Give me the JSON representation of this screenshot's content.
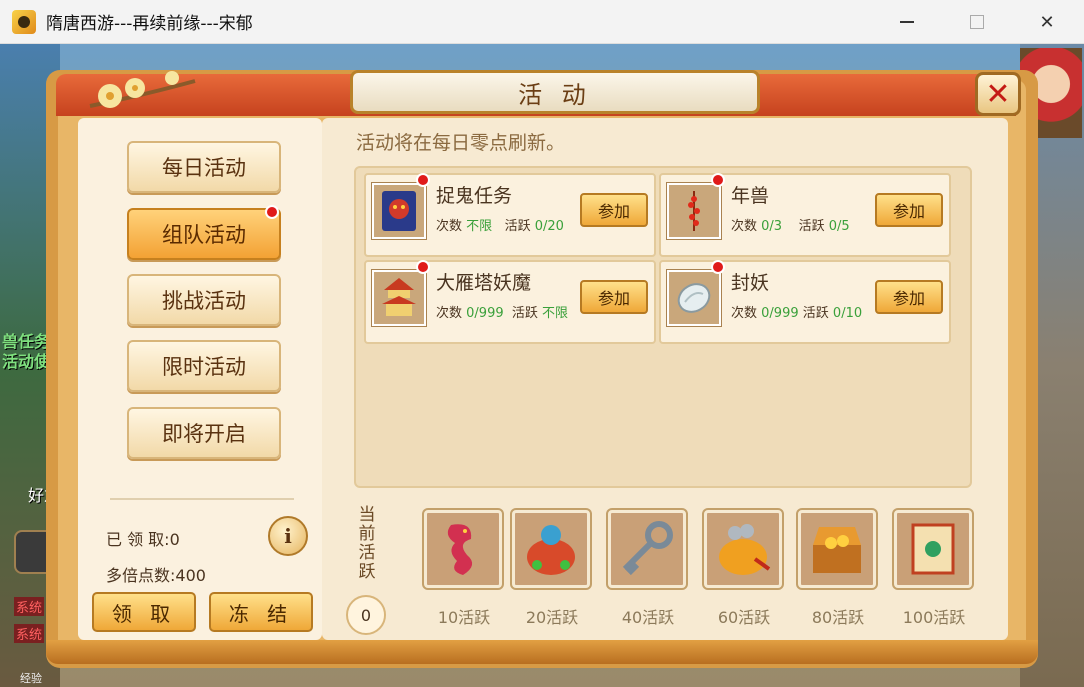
{
  "window": {
    "title": "隋唐西游---再续前缘---宋郁",
    "minimize": "—",
    "close": "✕"
  },
  "background": {
    "left_text_1": "兽任务",
    "left_text_2": "活动使者",
    "friend_label": "好友",
    "sys_tag_1": "系统",
    "sys_tag_2": "系统",
    "exp_label": "经验"
  },
  "panel": {
    "title": "活 动",
    "close_label": "✕"
  },
  "tabs": [
    {
      "label": "每日活动",
      "active": false,
      "dot": false
    },
    {
      "label": "组队活动",
      "active": true,
      "dot": true
    },
    {
      "label": "挑战活动",
      "active": false,
      "dot": false
    },
    {
      "label": "限时活动",
      "active": false,
      "dot": false
    },
    {
      "label": "即将开启",
      "active": false,
      "dot": false
    }
  ],
  "stats": {
    "claimed": "已 领 取:0",
    "multiplier": "多倍点数:400",
    "info_label": "i"
  },
  "buttons": {
    "claim": "领 取",
    "freeze": "冻 结"
  },
  "notice": "活动将在每日零点刷新。",
  "activities": [
    {
      "name": "捉鬼任务",
      "times_label": "次数",
      "times_value": "不限",
      "active_label": "活跃",
      "active_value": "0/20",
      "join": "参加",
      "icon": "ghost-scroll-icon"
    },
    {
      "name": "年兽",
      "times_label": "次数",
      "times_value": "0/3",
      "active_label": "活跃",
      "active_value": "0/5",
      "join": "参加",
      "icon": "firecracker-icon"
    },
    {
      "name": "大雁塔妖魔",
      "times_label": "次数",
      "times_value": "0/999",
      "active_label": "活跃",
      "active_value": "不限",
      "join": "参加",
      "icon": "pagoda-icon"
    },
    {
      "name": "封妖",
      "times_label": "次数",
      "times_value": "0/999",
      "active_label": "活跃",
      "active_value": "0/10",
      "join": "参加",
      "icon": "silver-stone-icon"
    }
  ],
  "progress": {
    "label": "当前活跃",
    "value": "0"
  },
  "rewards": [
    {
      "label": "10活跃",
      "icon": "dragon-icon"
    },
    {
      "label": "20活跃",
      "icon": "gem-bag-icon"
    },
    {
      "label": "40活跃",
      "icon": "key-icon"
    },
    {
      "label": "60活跃",
      "icon": "money-pouch-icon"
    },
    {
      "label": "80活跃",
      "icon": "treasure-chest-icon"
    },
    {
      "label": "100活跃",
      "icon": "scroll-icon"
    }
  ]
}
